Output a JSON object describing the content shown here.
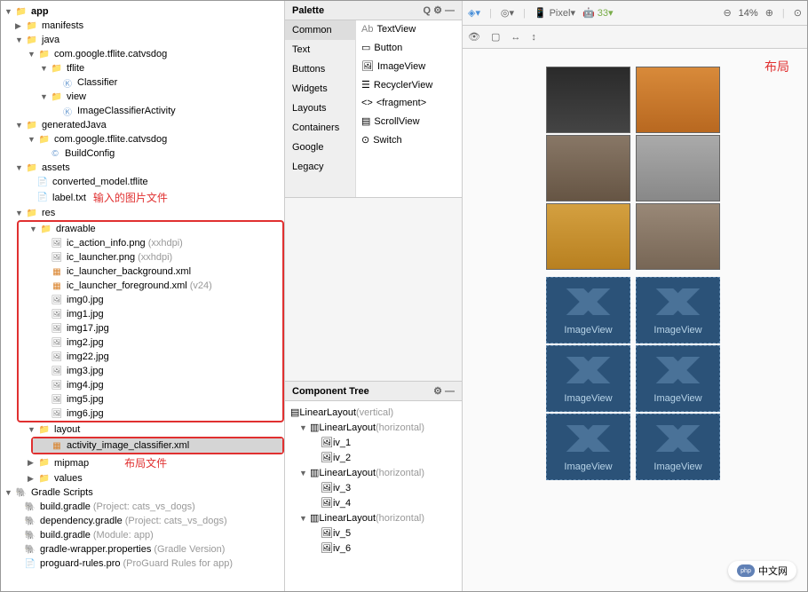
{
  "tree": {
    "app": "app",
    "manifests": "manifests",
    "java": "java",
    "pkg1": "com.google.tflite.catvsdog",
    "tflite": "tflite",
    "classifier": "Classifier",
    "view": "view",
    "ica": "ImageClassifierActivity",
    "genJava": "generatedJava",
    "pkg2": "com.google.tflite.catvsdog",
    "buildConfig": "BuildConfig",
    "assets": "assets",
    "model": "converted_model.tflite",
    "label": "label.txt",
    "res": "res",
    "drawable": "drawable",
    "d1": "ic_action_info.png",
    "d1q": "(xxhdpi)",
    "d2": "ic_launcher.png",
    "d2q": "(xxhdpi)",
    "d3": "ic_launcher_background.xml",
    "d4": "ic_launcher_foreground.xml",
    "d4q": "(v24)",
    "d5": "img0.jpg",
    "d6": "img1.jpg",
    "d7": "img17.jpg",
    "d8": "img2.jpg",
    "d9": "img22.jpg",
    "d10": "img3.jpg",
    "d11": "img4.jpg",
    "d12": "img5.jpg",
    "d13": "img6.jpg",
    "layout": "layout",
    "actxml": "activity_image_classifier.xml",
    "mipmap": "mipmap",
    "values": "values",
    "gradleScripts": "Gradle Scripts",
    "bg1": "build.gradle",
    "bg1q": "(Project: cats_vs_dogs)",
    "bg2": "dependency.gradle",
    "bg2q": "(Project: cats_vs_dogs)",
    "bg3": "build.gradle",
    "bg3q": "(Module: app)",
    "bg4": "gradle-wrapper.properties",
    "bg4q": "(Gradle Version)",
    "bg5": "proguard-rules.pro",
    "bg5q": "(ProGuard Rules for app)"
  },
  "annotations": {
    "inputFiles": "输入的图片文件",
    "layoutFile": "布局文件",
    "layoutLabel": "布局"
  },
  "palette": {
    "title": "Palette",
    "categories": [
      "Common",
      "Text",
      "Buttons",
      "Widgets",
      "Layouts",
      "Containers",
      "Google",
      "Legacy"
    ],
    "items": [
      "TextView",
      "Button",
      "ImageView",
      "RecyclerView",
      "<fragment>",
      "ScrollView",
      "Switch"
    ]
  },
  "componentTree": {
    "title": "Component Tree",
    "root": "LinearLayout",
    "rootq": "(vertical)",
    "ll1": "LinearLayout",
    "llq": "(horizontal)",
    "iv1": "iv_1",
    "iv2": "iv_2",
    "ll2": "LinearLayout",
    "iv3": "iv_3",
    "iv4": "iv_4",
    "ll3": "LinearLayout",
    "iv5": "iv_5",
    "iv6": "iv_6"
  },
  "toolbar": {
    "device": "Pixel",
    "api": "33",
    "zoom": "14%",
    "placeholder": "ImageView"
  },
  "watermark": {
    "php": "php",
    "text": "中文网"
  }
}
